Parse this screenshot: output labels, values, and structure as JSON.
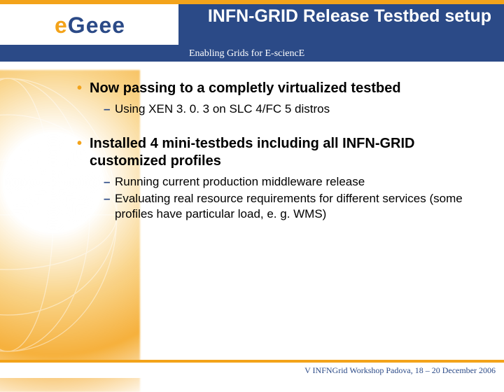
{
  "header": {
    "logo_text_a": "e",
    "logo_text_b": "eee",
    "logo_text_c": "G",
    "title": "INFN-GRID Release Testbed setup",
    "tagline": "Enabling Grids for E-sciencE"
  },
  "bullets": [
    {
      "text": "Now passing to a completly virtualized testbed",
      "sub": [
        "Using XEN 3. 0. 3 on SLC 4/FC 5 distros"
      ]
    },
    {
      "text": "Installed 4 mini-testbeds including all INFN-GRID customized profiles",
      "sub": [
        "Running current production middleware release",
        "Evaluating real resource requirements for different services (some profiles have particular load, e. g. WMS)"
      ]
    }
  ],
  "footer": {
    "text": "V INFNGrid Workshop Padova, 18 – 20 December 2006"
  }
}
